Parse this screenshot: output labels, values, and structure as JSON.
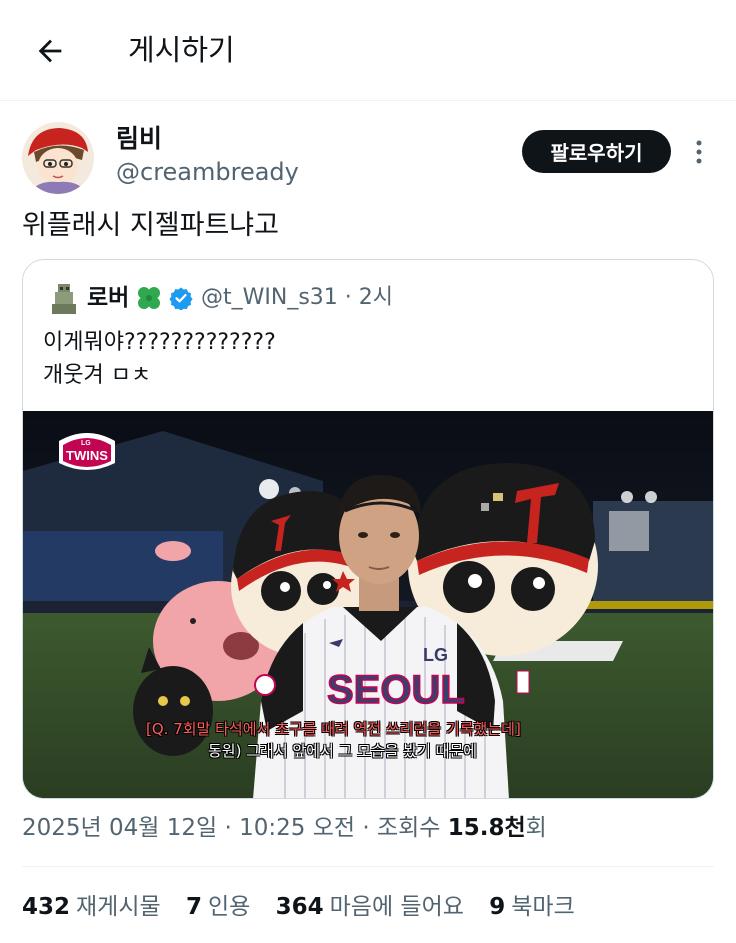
{
  "header": {
    "title": "게시하기",
    "back_icon": "arrow-left-icon"
  },
  "post": {
    "author": {
      "display_name": "림비",
      "handle": "@creambready"
    },
    "follow_label": "팔로우하기",
    "more_icon": "more-vertical-icon",
    "text": "위플래시 지젤파트냐고",
    "quote": {
      "author_name": "로버",
      "handle_time": "@t_WIN_s31 · 2시",
      "text_line1": "이게뭐야?????????????",
      "text_line2": "개웃겨 ㅁㅊ",
      "media": {
        "logo_small": "LG",
        "logo_text": "TWINS",
        "jersey_small": "LG",
        "jersey_text": "SEOUL",
        "caption_line1": "[Q. 7회말 타석에서 초구를 때려 역전 쓰리런을 기록했는데]",
        "caption_line2": "동원) 그래서 앞에서 그 모습을 봤기 때문에"
      }
    },
    "meta": {
      "date_time": "2025년 04월 12일 · 10:25 오전 · 조회수 ",
      "views": "15.8천",
      "views_suffix": "회"
    },
    "stats": {
      "reposts_count": "432",
      "reposts_label": "재게시물",
      "quotes_count": "7",
      "quotes_label": "인용",
      "likes_count": "364",
      "likes_label": "마음에 들어요",
      "bookmarks_count": "9",
      "bookmarks_label": "북마크"
    }
  },
  "colors": {
    "text_primary": "#0f1419",
    "text_secondary": "#536471",
    "border": "#cfd9de",
    "divider": "#eff3f4",
    "follow_bg": "#0f1419",
    "verified_blue": "#1d9bf0",
    "twins_red": "#c30452"
  }
}
